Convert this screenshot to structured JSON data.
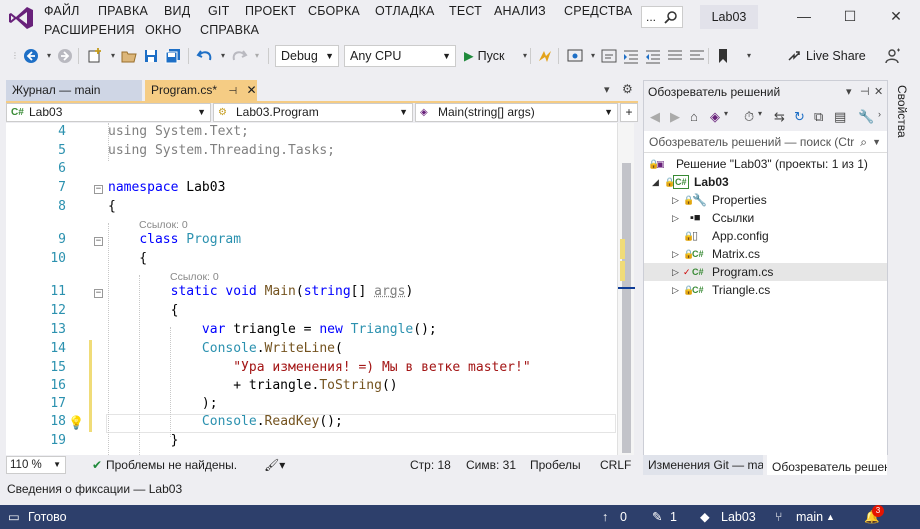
{
  "window": {
    "title_badge": "Lab03",
    "search_placeholder": "...",
    "controls": {
      "minimize": "—",
      "maximize": "☐",
      "close": "✕"
    }
  },
  "menu": [
    {
      "id": "file",
      "label": "ФАЙЛ"
    },
    {
      "id": "edit",
      "label": "ПРАВКА"
    },
    {
      "id": "view",
      "label": "ВИД"
    },
    {
      "id": "git",
      "label": "GIT"
    },
    {
      "id": "project",
      "label": "ПРОЕКТ"
    },
    {
      "id": "build",
      "label": "СБОРКА"
    },
    {
      "id": "debug",
      "label": "ОТЛАДКА"
    },
    {
      "id": "test",
      "label": "ТЕСТ"
    },
    {
      "id": "analyze",
      "label": "АНАЛИЗ"
    },
    {
      "id": "tools",
      "label": "СРЕДСТВА"
    },
    {
      "id": "extensions",
      "label": "РАСШИРЕНИЯ"
    },
    {
      "id": "window",
      "label": "ОКНО"
    },
    {
      "id": "help",
      "label": "СПРАВКА"
    }
  ],
  "toolbar": {
    "configuration": "Debug",
    "platform": "Any CPU",
    "run_label": "Пуск",
    "live_share": "Live Share"
  },
  "tabs": {
    "journal": "Журнал — main",
    "program": "Program.cs*",
    "program_pin": "⊣",
    "program_close": "✕"
  },
  "navbar": {
    "project": "Lab03",
    "class": "Lab03.Program",
    "member": "Main(string[] args)"
  },
  "code": {
    "lines": [
      {
        "n": "4",
        "html": "<span class='dim'>using System.Text;</span>"
      },
      {
        "n": "5",
        "html": "<span class='dim'>using System.Threading.Tasks;</span>"
      },
      {
        "n": "6",
        "html": ""
      },
      {
        "n": "7",
        "html": "<span class='kw'>namespace</span> Lab03"
      },
      {
        "n": "8",
        "html": "{"
      },
      {
        "n": "9",
        "html": "    <span class='kw'>class</span> <span class='ty'>Program</span>"
      },
      {
        "n": "10",
        "html": "    {"
      },
      {
        "n": "11",
        "html": "        <span class='kw'>static</span> <span class='kw'>void</span> <span class='fn'>Main</span>(<span class='kw'>string</span>[] <span class='param'>args</span>)"
      },
      {
        "n": "12",
        "html": "        {"
      },
      {
        "n": "13",
        "html": "            <span class='kw'>var</span> triangle = <span class='kw'>new</span> <span class='ty'>Triangle</span>();"
      },
      {
        "n": "14",
        "html": "            <span class='ty'>Console</span>.<span class='fn'>WriteLine</span>("
      },
      {
        "n": "15",
        "html": "                <span class='st'>\"Ура изменения! =) Мы в ветке master!\"</span>"
      },
      {
        "n": "16",
        "html": "                + triangle.<span class='fn'>ToString</span>()"
      },
      {
        "n": "17",
        "html": "            );"
      },
      {
        "n": "18",
        "html": "            <span class='ty'>Console</span>.<span class='fn'>ReadKey</span>();"
      },
      {
        "n": "19",
        "html": "        }"
      }
    ],
    "lens_class": "Ссылок: 0",
    "lens_method": "Ссылок: 0",
    "collapse_symbol": "−"
  },
  "editor_status": {
    "zoom": "110 %",
    "problems": "Проблемы не найдены.",
    "line": "Стр: 18",
    "col": "Симв: 31",
    "spaces": "Пробелы",
    "eol": "CRLF"
  },
  "commit_panel": {
    "title": "Сведения о фиксации — Lab03"
  },
  "statusbar": {
    "ready": "Готово",
    "up_count": "0",
    "edit_count": "1",
    "repo": "Lab03",
    "branch": "main",
    "notifications": "3"
  },
  "solution_explorer": {
    "title": "Обозреватель решений",
    "search_placeholder": "Обозреватель решений — поиск (Ctr",
    "tree": [
      {
        "label": "Решение \"Lab03\" (проекты: 1 из 1)",
        "level": 0,
        "icon": "sln"
      },
      {
        "label": "Lab03",
        "level": 1,
        "icon": "C#",
        "bold": true,
        "expanded": true
      },
      {
        "label": "Properties",
        "level": 2,
        "icon": "wrench",
        "expandable": true
      },
      {
        "label": "Ссылки",
        "level": 2,
        "icon": "refs",
        "expandable": true
      },
      {
        "label": "App.config",
        "level": 2,
        "icon": "config"
      },
      {
        "label": "Matrix.cs",
        "level": 2,
        "icon": "C#",
        "expandable": true
      },
      {
        "label": "Program.cs",
        "level": 2,
        "icon": "C#",
        "expandable": true,
        "selected": true,
        "modified": true
      },
      {
        "label": "Triangle.cs",
        "level": 2,
        "icon": "C#",
        "expandable": true
      }
    ],
    "tab_git": "Изменения Git — main",
    "tab_solution": "Обозреватель решений"
  },
  "properties_rail": {
    "label": "Свойства"
  }
}
